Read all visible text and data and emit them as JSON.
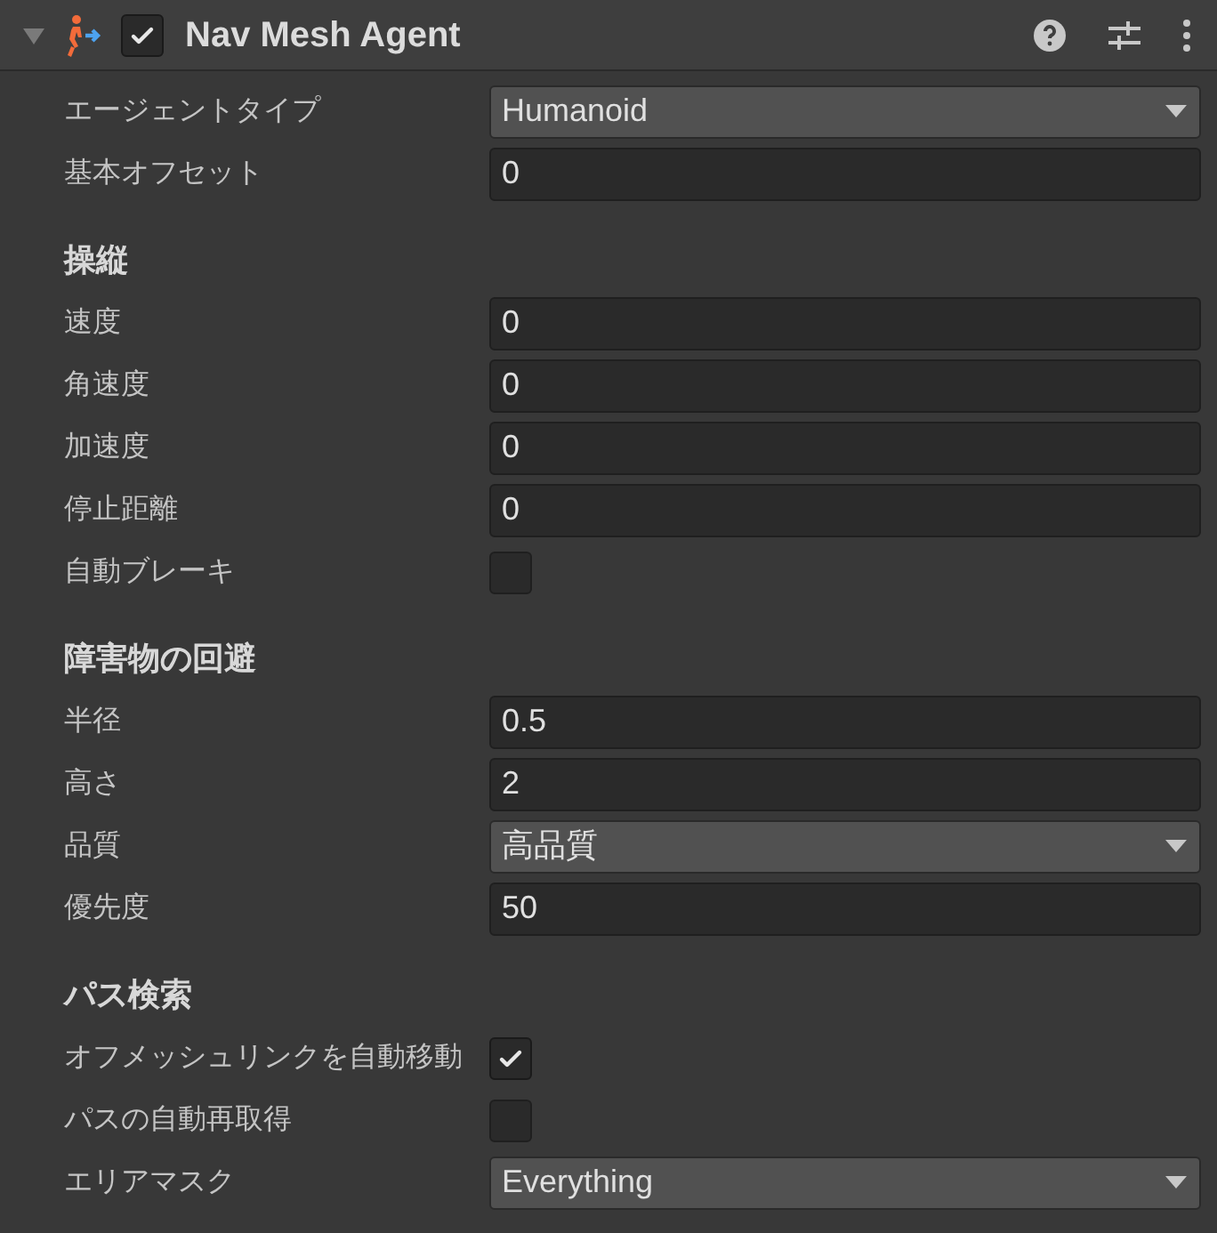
{
  "header": {
    "expanded": true,
    "enabled": true,
    "title": "Nav Mesh Agent"
  },
  "sections": [
    {
      "rows": [
        {
          "kind": "dropdown",
          "label": "エージェントタイプ",
          "value": "Humanoid"
        },
        {
          "kind": "number",
          "label": "基本オフセット",
          "value": "0"
        }
      ]
    },
    {
      "heading": "操縦",
      "rows": [
        {
          "kind": "number",
          "label": "速度",
          "value": "0"
        },
        {
          "kind": "number",
          "label": "角速度",
          "value": "0"
        },
        {
          "kind": "number",
          "label": "加速度",
          "value": "0"
        },
        {
          "kind": "number",
          "label": "停止距離",
          "value": "0"
        },
        {
          "kind": "checkbox",
          "label": "自動ブレーキ",
          "checked": false
        }
      ]
    },
    {
      "heading": "障害物の回避",
      "rows": [
        {
          "kind": "number",
          "label": "半径",
          "value": "0.5"
        },
        {
          "kind": "number",
          "label": "高さ",
          "value": "2"
        },
        {
          "kind": "dropdown",
          "label": "品質",
          "value": "高品質"
        },
        {
          "kind": "number",
          "label": "優先度",
          "value": "50"
        }
      ]
    },
    {
      "heading": "パス検索",
      "rows": [
        {
          "kind": "checkbox",
          "label": "オフメッシュリンクを自動移動",
          "checked": true
        },
        {
          "kind": "checkbox",
          "label": "パスの自動再取得",
          "checked": false
        },
        {
          "kind": "dropdown",
          "label": "エリアマスク",
          "value": "Everything"
        }
      ]
    }
  ]
}
